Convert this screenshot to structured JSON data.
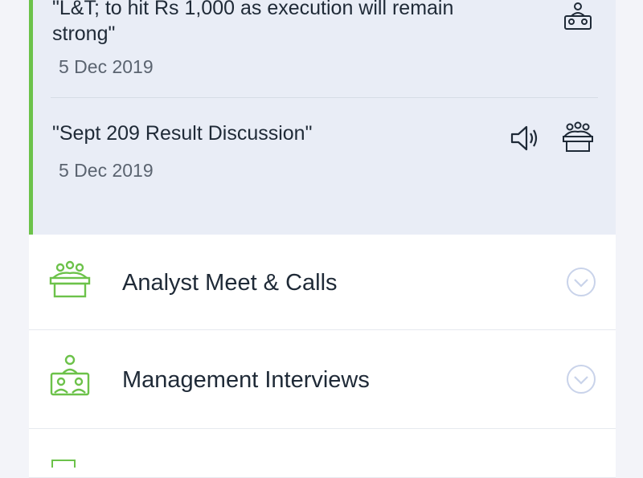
{
  "items": [
    {
      "title": "\"L&T; to hit Rs 1,000 as execution will remain strong\"",
      "date": "5 Dec 2019",
      "icons": [
        "meeting-icon"
      ]
    },
    {
      "title": "\"Sept 209 Result Discussion\"",
      "date": "5 Dec 2019",
      "icons": [
        "audio-icon",
        "meeting-icon"
      ]
    }
  ],
  "sections": [
    {
      "label": "Analyst Meet & Calls",
      "icon": "podium-group-icon"
    },
    {
      "label": "Management Interviews",
      "icon": "interview-icon"
    }
  ],
  "colors": {
    "accent": "#6cc24a",
    "chevron": "#c9d3ea",
    "expanded_bg": "#e9edf6",
    "page_bg": "#f3f4f9"
  }
}
